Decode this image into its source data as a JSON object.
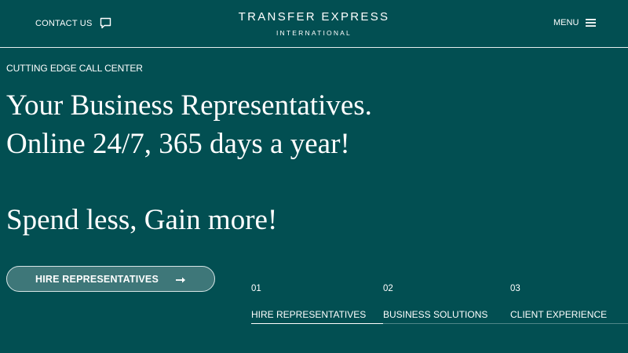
{
  "header": {
    "contact_label": "CONTACT US",
    "brand_title": "TRANSFER EXPRESS",
    "brand_subtitle": "INTERNATIONAL",
    "menu_label": "MENU"
  },
  "hero": {
    "eyebrow": "CUTTING EDGE CALL CENTER",
    "headline_line1": "Your Business Representatives.",
    "headline_line2": "Online 24/7, 365 days a year!",
    "headline_line3": "Spend less, Gain more!",
    "cta_label": "HIRE REPRESENTATIVES"
  },
  "steps": [
    {
      "number": "01",
      "label": "HIRE REPRESENTATIVES",
      "active": true
    },
    {
      "number": "02",
      "label": "BUSINESS SOLUTIONS",
      "active": false
    },
    {
      "number": "03",
      "label": "CLIENT EXPERIENCE",
      "active": false
    }
  ],
  "colors": {
    "background": "#024f52",
    "button_fill": "#3e7779",
    "text": "#ffffff"
  },
  "icons": {
    "contact": "chat-bubble-icon",
    "menu": "hamburger-icon",
    "cta": "arrow-right-icon"
  }
}
